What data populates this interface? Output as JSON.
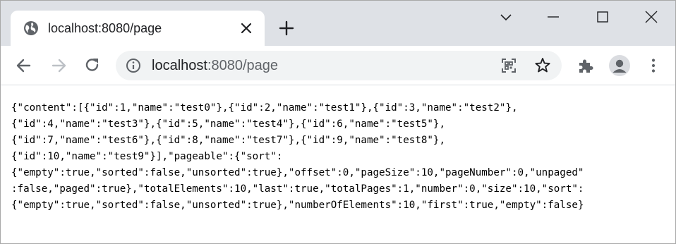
{
  "browser": {
    "tab": {
      "title": "localhost:8080/page",
      "favicon": "globe-icon"
    },
    "address_bar": {
      "host": "localhost",
      "port_path": ":8080/page"
    },
    "icons": {
      "back": "arrow-left-icon",
      "forward": "arrow-right-icon",
      "reload": "reload-icon",
      "site_info": "info-icon",
      "qr": "qr-code-icon",
      "bookmark": "star-icon",
      "extensions": "puzzle-icon",
      "profile": "avatar-icon",
      "menu": "kebab-menu-icon",
      "new_tab": "plus-icon",
      "tab_search": "chevron-down-icon",
      "minimize": "minimize-icon",
      "maximize": "maximize-icon",
      "close": "close-icon"
    },
    "colors": {
      "tabstrip": "#dee1e6",
      "omnibox": "#f1f3f4",
      "icon": "#5f6368"
    }
  },
  "page": {
    "lines": [
      "{\"content\":[{\"id\":1,\"name\":\"test0\"},{\"id\":2,\"name\":\"test1\"},{\"id\":3,\"name\":\"test2\"},",
      "{\"id\":4,\"name\":\"test3\"},{\"id\":5,\"name\":\"test4\"},{\"id\":6,\"name\":\"test5\"},",
      "{\"id\":7,\"name\":\"test6\"},{\"id\":8,\"name\":\"test7\"},{\"id\":9,\"name\":\"test8\"},",
      "{\"id\":10,\"name\":\"test9\"}],\"pageable\":{\"sort\":",
      "{\"empty\":true,\"sorted\":false,\"unsorted\":true},\"offset\":0,\"pageSize\":10,\"pageNumber\":0,\"unpaged\"",
      ":false,\"paged\":true},\"totalElements\":10,\"last\":true,\"totalPages\":1,\"number\":0,\"size\":10,\"sort\":",
      "{\"empty\":true,\"sorted\":false,\"unsorted\":true},\"numberOfElements\":10,\"first\":true,\"empty\":false}"
    ]
  }
}
